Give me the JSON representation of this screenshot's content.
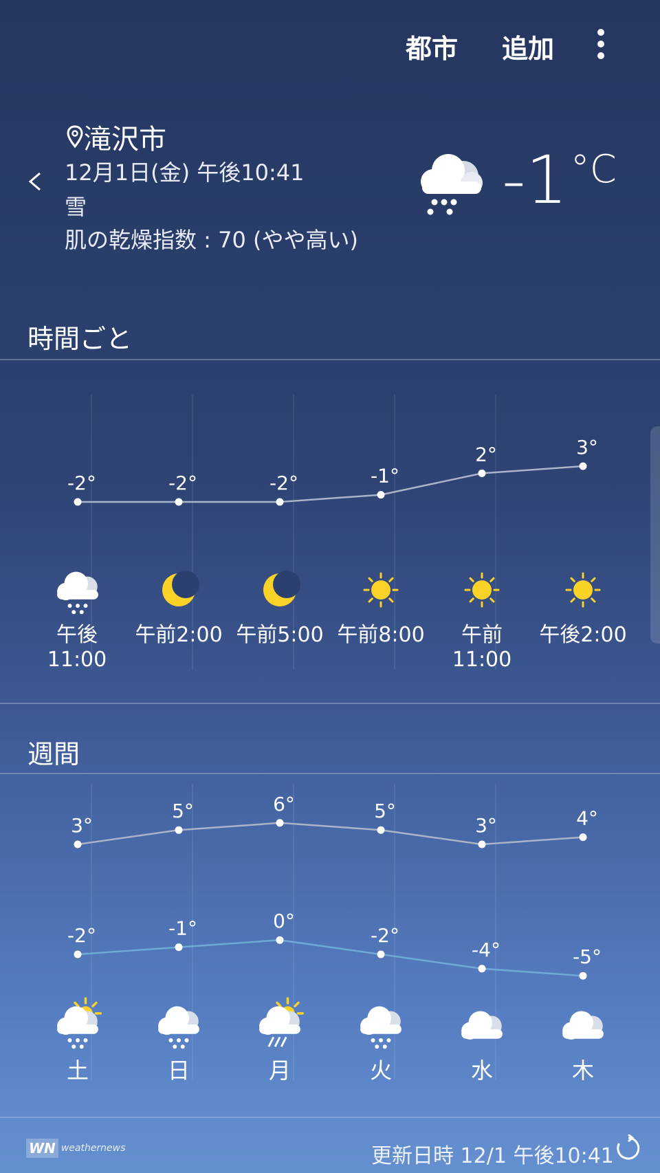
{
  "topbar": {
    "city_label": "都市",
    "add_label": "追加"
  },
  "current": {
    "location": "滝沢市",
    "datetime": "12月1日(金) 午後10:41",
    "condition": "雪",
    "skin_dryness": "肌の乾燥指数 : 70 (やや高い)",
    "temperature": "-1",
    "unit": "°C",
    "icon": "snow-cloud-icon"
  },
  "hourly": {
    "title": "時間ごと",
    "items": [
      {
        "time": "午後11:00",
        "temp": -2,
        "temp_label": "-2°",
        "icon": "snow"
      },
      {
        "time": "午前2:00",
        "temp": -2,
        "temp_label": "-2°",
        "icon": "moon"
      },
      {
        "time": "午前5:00",
        "temp": -2,
        "temp_label": "-2°",
        "icon": "moon"
      },
      {
        "time": "午前8:00",
        "temp": -1,
        "temp_label": "-1°",
        "icon": "sun"
      },
      {
        "time": "午前11:00",
        "temp": 2,
        "temp_label": "2°",
        "icon": "sun"
      },
      {
        "time": "午後2:00",
        "temp": 3,
        "temp_label": "3°",
        "icon": "sun"
      }
    ]
  },
  "weekly": {
    "title": "週間",
    "items": [
      {
        "day": "土",
        "high": 3,
        "high_label": "3°",
        "low": -2,
        "low_label": "-2°",
        "icon": "snow-sun"
      },
      {
        "day": "日",
        "high": 5,
        "high_label": "5°",
        "low": -1,
        "low_label": "-1°",
        "icon": "snow"
      },
      {
        "day": "月",
        "high": 6,
        "high_label": "6°",
        "low": 0,
        "low_label": "0°",
        "icon": "rain-sun"
      },
      {
        "day": "火",
        "high": 5,
        "high_label": "5°",
        "low": -2,
        "low_label": "-2°",
        "icon": "snow"
      },
      {
        "day": "水",
        "high": 3,
        "high_label": "3°",
        "low": -4,
        "low_label": "-4°",
        "icon": "cloud"
      },
      {
        "day": "木",
        "high": 4,
        "high_label": "4°",
        "low": -5,
        "low_label": "-5°",
        "icon": "cloud"
      }
    ]
  },
  "footer": {
    "logo_mark": "WN",
    "logo_brand": "weathernews",
    "updated": "更新日時 12/1 午後10:41"
  },
  "colors": {
    "sun": "#fbd228",
    "moon": "#fbd228",
    "high_line": "#aab3c8",
    "low_line": "#6eaad6"
  }
}
